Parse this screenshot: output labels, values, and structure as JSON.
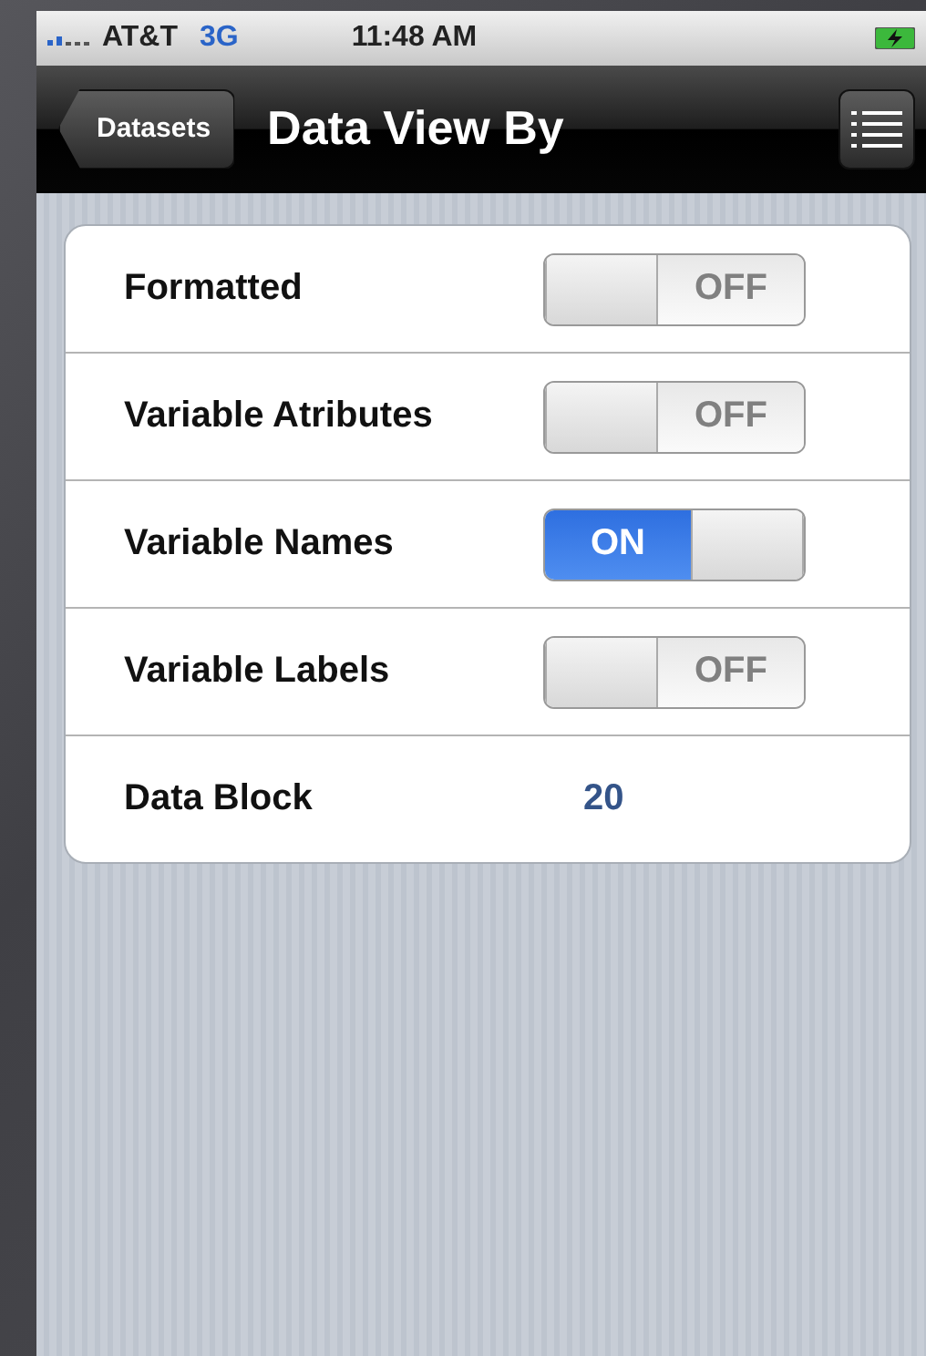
{
  "status_bar": {
    "carrier": "AT&T",
    "network": "3G",
    "time": "11:48 AM"
  },
  "nav_bar": {
    "back_button": "Datasets",
    "title": "Data View By"
  },
  "settings": [
    {
      "kind": "toggle",
      "label": "Formatted",
      "on": false,
      "switch_text": "OFF"
    },
    {
      "kind": "toggle",
      "label": "Variable Atributes",
      "on": false,
      "switch_text": "OFF"
    },
    {
      "kind": "toggle",
      "label": "Variable Names",
      "on": true,
      "switch_text": "ON"
    },
    {
      "kind": "toggle",
      "label": "Variable Labels",
      "on": false,
      "switch_text": "OFF"
    },
    {
      "kind": "value",
      "label": "Data Block",
      "value": "20"
    }
  ]
}
